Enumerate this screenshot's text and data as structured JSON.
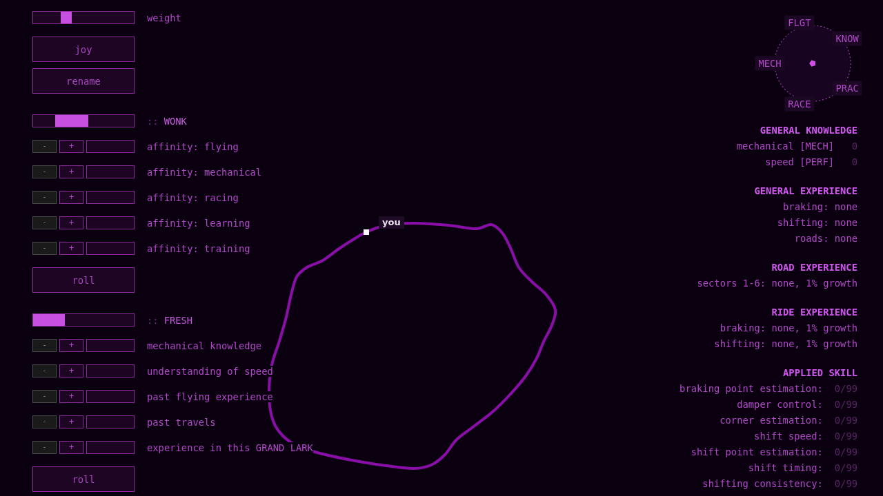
{
  "left_panel": {
    "groups": [
      {
        "items": [
          {
            "kind": "slider",
            "label": "weight",
            "level": 0.31
          },
          {
            "kind": "button",
            "text": "joy"
          },
          {
            "kind": "button",
            "text": "rename"
          }
        ]
      },
      {
        "items": [
          {
            "kind": "band",
            "prefix": "::",
            "label": "WONK",
            "level": 0.33
          },
          {
            "kind": "stepper",
            "label": "affinity: flying",
            "decrease": {
              "text": "-",
              "disabled": true
            },
            "increase": {
              "text": "+",
              "disabled": false
            }
          },
          {
            "kind": "stepper",
            "label": "affinity: mechanical",
            "decrease": {
              "text": "-",
              "disabled": true
            },
            "increase": {
              "text": "+",
              "disabled": false
            }
          },
          {
            "kind": "stepper",
            "label": "affinity: racing",
            "decrease": {
              "text": "-",
              "disabled": true
            },
            "increase": {
              "text": "+",
              "disabled": false
            }
          },
          {
            "kind": "stepper",
            "label": "affinity: learning",
            "decrease": {
              "text": "-",
              "disabled": true
            },
            "increase": {
              "text": "+",
              "disabled": false
            }
          },
          {
            "kind": "stepper",
            "label": "affinity: training",
            "decrease": {
              "text": "-",
              "disabled": true
            },
            "increase": {
              "text": "+",
              "disabled": false
            }
          },
          {
            "kind": "button",
            "text": "roll"
          }
        ]
      },
      {
        "items": [
          {
            "kind": "progress",
            "prefix": "::",
            "label": "FRESH",
            "level": 0.32
          },
          {
            "kind": "stepper",
            "label": "mechanical knowledge",
            "decrease": {
              "text": "-",
              "disabled": true
            },
            "increase": {
              "text": "+",
              "disabled": false
            }
          },
          {
            "kind": "stepper",
            "label": "understanding of speed",
            "decrease": {
              "text": "-",
              "disabled": true
            },
            "increase": {
              "text": "+",
              "disabled": false
            }
          },
          {
            "kind": "stepper",
            "label": "past flying experience",
            "decrease": {
              "text": "-",
              "disabled": true
            },
            "increase": {
              "text": "+",
              "disabled": false
            }
          },
          {
            "kind": "stepper",
            "label": "past travels",
            "decrease": {
              "text": "-",
              "disabled": true
            },
            "increase": {
              "text": "+",
              "disabled": false
            }
          },
          {
            "kind": "stepper",
            "label": "experience in this GRAND LARK",
            "decrease": {
              "text": "-",
              "disabled": true
            },
            "increase": {
              "text": "+",
              "disabled": false
            }
          },
          {
            "kind": "button",
            "text": "roll"
          }
        ]
      }
    ]
  },
  "map": {
    "player_label": "you"
  },
  "radar": {
    "axes": [
      "FLGT",
      "KNOW",
      "PRAC",
      "RACE",
      "MECH"
    ]
  },
  "sections": [
    {
      "title": "GENERAL KNOWLEDGE",
      "rows": [
        {
          "label": "mechanical [MECH]",
          "value": "0"
        },
        {
          "label": "speed [PERF]",
          "value": "0"
        }
      ]
    },
    {
      "title": "GENERAL EXPERIENCE",
      "rows": [
        {
          "label": "braking: none"
        },
        {
          "label": "shifting: none"
        },
        {
          "label": "roads: none"
        }
      ]
    },
    {
      "title": "ROAD EXPERIENCE",
      "rows": [
        {
          "label": "sectors 1-6: none, 1% growth"
        }
      ]
    },
    {
      "title": "RIDE EXPERIENCE",
      "rows": [
        {
          "label": "braking: none, 1% growth"
        },
        {
          "label": "shifting: none, 1% growth"
        }
      ]
    },
    {
      "title": "APPLIED SKILL",
      "rows": [
        {
          "label": "braking point estimation:",
          "value": "0/99"
        },
        {
          "label": "damper control:",
          "value": "0/99"
        },
        {
          "label": "corner estimation:",
          "value": "0/99"
        },
        {
          "label": "shift speed:",
          "value": "0/99"
        },
        {
          "label": "shift point estimation:",
          "value": "0/99"
        },
        {
          "label": "shift timing:",
          "value": "0/99"
        },
        {
          "label": "shifting consistency:",
          "value": "0/99"
        }
      ]
    }
  ]
}
